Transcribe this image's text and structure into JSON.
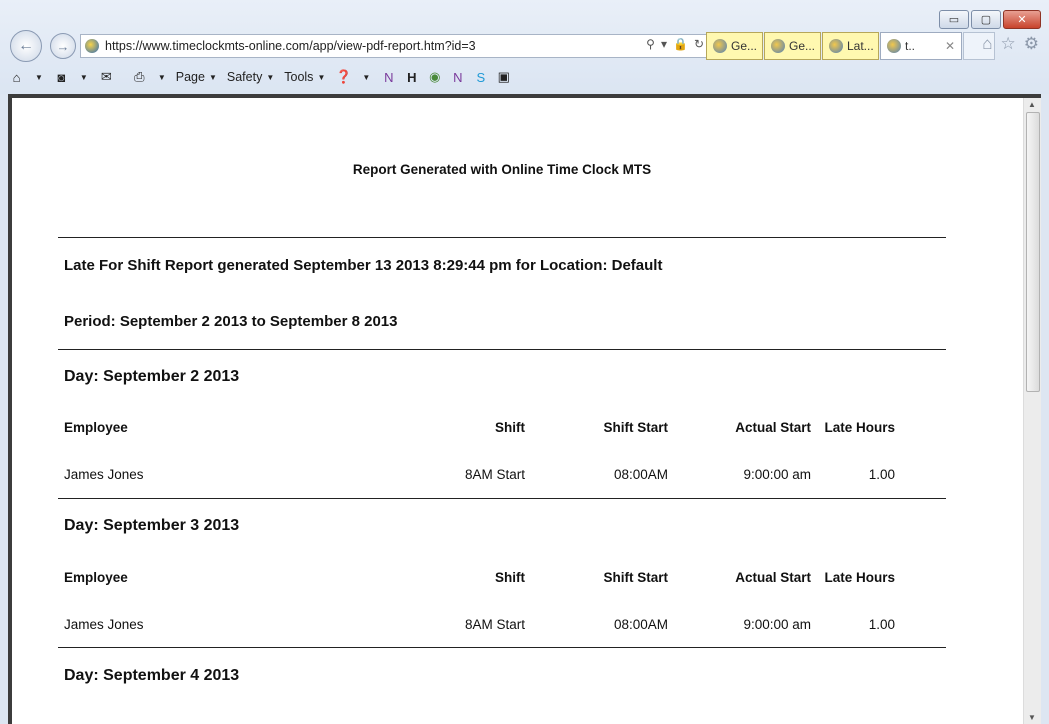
{
  "browser": {
    "url": "https://www.timeclockmts-online.com/app/view-pdf-report.htm?id=3",
    "tabs": [
      {
        "label": "Ge...",
        "active": false
      },
      {
        "label": "Ge...",
        "active": false
      },
      {
        "label": "Lat...",
        "active": false
      },
      {
        "label": "t..",
        "active": true
      }
    ],
    "menu": {
      "page": "Page",
      "safety": "Safety",
      "tools": "Tools"
    }
  },
  "report": {
    "generated_title": "Report Generated with Online Time Clock MTS",
    "heading": "Late For Shift Report generated September 13 2013 8:29:44 pm for Location: Default",
    "period": "Period: September 2 2013 to September 8 2013",
    "columns": {
      "employee": "Employee",
      "shift": "Shift",
      "shift_start": "Shift Start",
      "actual_start": "Actual Start",
      "late_hours": "Late Hours"
    },
    "days": [
      {
        "label": "Day: September 2 2013",
        "rows": [
          {
            "employee": "James Jones",
            "shift": "8AM Start",
            "shift_start": "08:00AM",
            "actual_start": "9:00:00 am",
            "late_hours": "1.00"
          }
        ]
      },
      {
        "label": "Day: September 3 2013",
        "rows": [
          {
            "employee": "James Jones",
            "shift": "8AM Start",
            "shift_start": "08:00AM",
            "actual_start": "9:00:00 am",
            "late_hours": "1.00"
          }
        ]
      },
      {
        "label": "Day: September 4 2013",
        "rows": []
      }
    ]
  }
}
